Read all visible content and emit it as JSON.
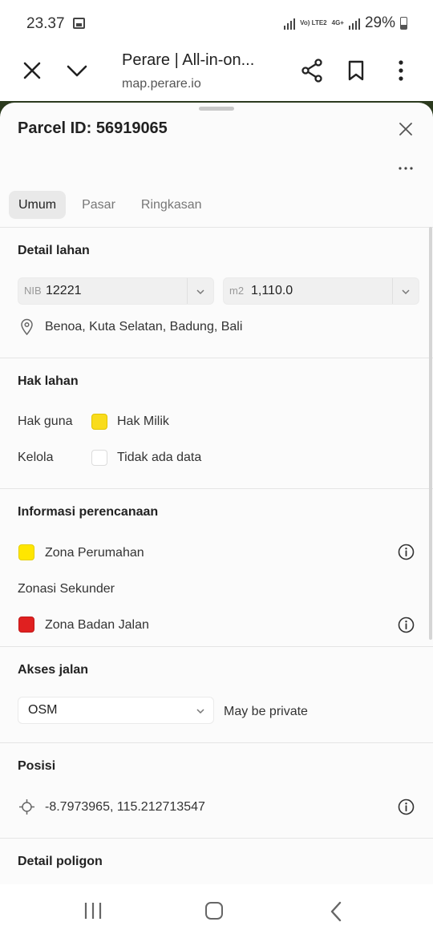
{
  "status_bar": {
    "time": "23.37",
    "network_label_1": "Vo) LTE2",
    "network_label_2": "4G+",
    "battery": "29%"
  },
  "browser": {
    "title": "Perare | All-in-on...",
    "url": "map.perare.io"
  },
  "parcel": {
    "title": "Parcel ID: 56919065"
  },
  "tabs": [
    {
      "label": "Umum",
      "active": true
    },
    {
      "label": "Pasar",
      "active": false
    },
    {
      "label": "Ringkasan",
      "active": false
    }
  ],
  "detail_lahan": {
    "title": "Detail lahan",
    "nib_prefix": "NIB",
    "nib_value": "12221",
    "area_prefix": "m2",
    "area_value": "1,110.0",
    "location": "Benoa, Kuta Selatan, Badung, Bali"
  },
  "hak_lahan": {
    "title": "Hak lahan",
    "rows": [
      {
        "label": "Hak guna",
        "value": "Hak Milik",
        "color": "#f9dc1c"
      },
      {
        "label": "Kelola",
        "value": "Tidak ada data",
        "color": "#ffffff"
      }
    ]
  },
  "perencanaan": {
    "title": "Informasi perencanaan",
    "primary_zone": {
      "label": "Zona Perumahan",
      "color": "#ffe600"
    },
    "secondary_title": "Zonasi Sekunder",
    "secondary_zone": {
      "label": "Zona Badan Jalan",
      "color": "#e02020"
    }
  },
  "akses_jalan": {
    "title": "Akses jalan",
    "source": "OSM",
    "note": "May be private"
  },
  "posisi": {
    "title": "Posisi",
    "coordinates": "-8.7973965, 115.212713547"
  },
  "detail_poligon": {
    "title": "Detail poligon"
  },
  "icons": {
    "close": "close-icon",
    "chevron": "chevron-down-icon",
    "share": "share-icon",
    "bookmark": "bookmark-icon",
    "more": "more-vertical-icon",
    "location": "location-pin-icon",
    "info": "info-icon",
    "crosshair": "crosshair-icon"
  }
}
